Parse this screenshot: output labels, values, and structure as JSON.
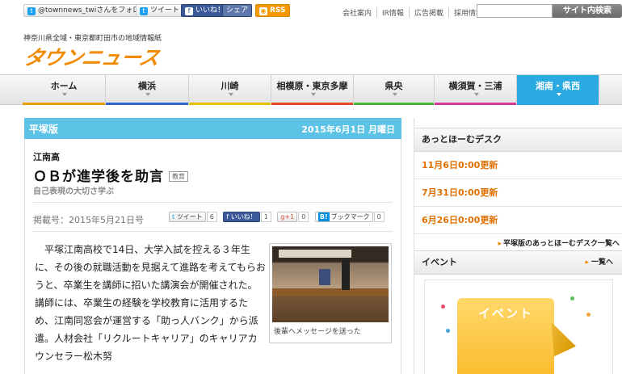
{
  "topbar": {
    "twitter_follow": "@townnews_twiさんをフォロー",
    "tweet": "ツイート",
    "fb_like": "いいね！",
    "fb_share": "シェア",
    "rss": "RSS",
    "links": [
      "会社案内",
      "IR情報",
      "広告掲載",
      "採用情報"
    ],
    "search_placeholder": "",
    "search_button": "サイト内検索"
  },
  "header": {
    "tagline": "神奈川県全域・東京都町田市の地域情報紙",
    "logo_text": "タウンニュース"
  },
  "nav": {
    "items": [
      {
        "label": "ホーム",
        "color": "#e8a000"
      },
      {
        "label": "横浜",
        "color": "#2f63c5"
      },
      {
        "label": "川崎",
        "color": "#e5c100"
      },
      {
        "label": "相模原・東京多摩",
        "color": "#e34a2b"
      },
      {
        "label": "県央",
        "color": "#47b33f"
      },
      {
        "label": "横須賀・三浦",
        "color": "#d8389a"
      },
      {
        "label": "湘南・県西",
        "color": "#29abe2"
      }
    ]
  },
  "article": {
    "edition": "平塚版",
    "date": "2015年6月1日 月曜日",
    "kicker": "江南高",
    "title": "ＯＢが進学後を助言",
    "tag": "教育",
    "subtitle": "自己表現の大切さ学ぶ",
    "pub_date": "掲載号：2015年5月21日号",
    "share": {
      "tweet_label": "ツイート",
      "tweet_count": "6",
      "fb_label": "いいね！",
      "fb_count": "1",
      "gplus_label": "g+1",
      "gplus_count": "0",
      "hatena_mark": "B!",
      "hatena_label": "ブックマーク",
      "hatena_count": "0"
    },
    "body": "平塚江南高校で14日、大学入試を控える３年生に、その後の就職活動を見据えて進路を考えてもらおうと、卒業生を講師に招いた講演会が開催された。講師には、卒業生の経験を学校教育に活用するため、江南同窓会が運営する「助っ人バンク」から派遣。人材会社「リクルートキャリア」のキャリアカウンセラー松木努",
    "photo_caption": "後輩へメッセージを送った"
  },
  "sidebar": {
    "desk_title": "あっとほーむデスク",
    "desk_items": [
      "11月6日0:00更新",
      "7月31日0:00更新",
      "6月26日0:00更新"
    ],
    "desk_more": "平塚版のあっとほーむデスク一覧へ",
    "event_title": "イベント",
    "event_more": "一覧へ",
    "event_card_label": "イベント"
  }
}
